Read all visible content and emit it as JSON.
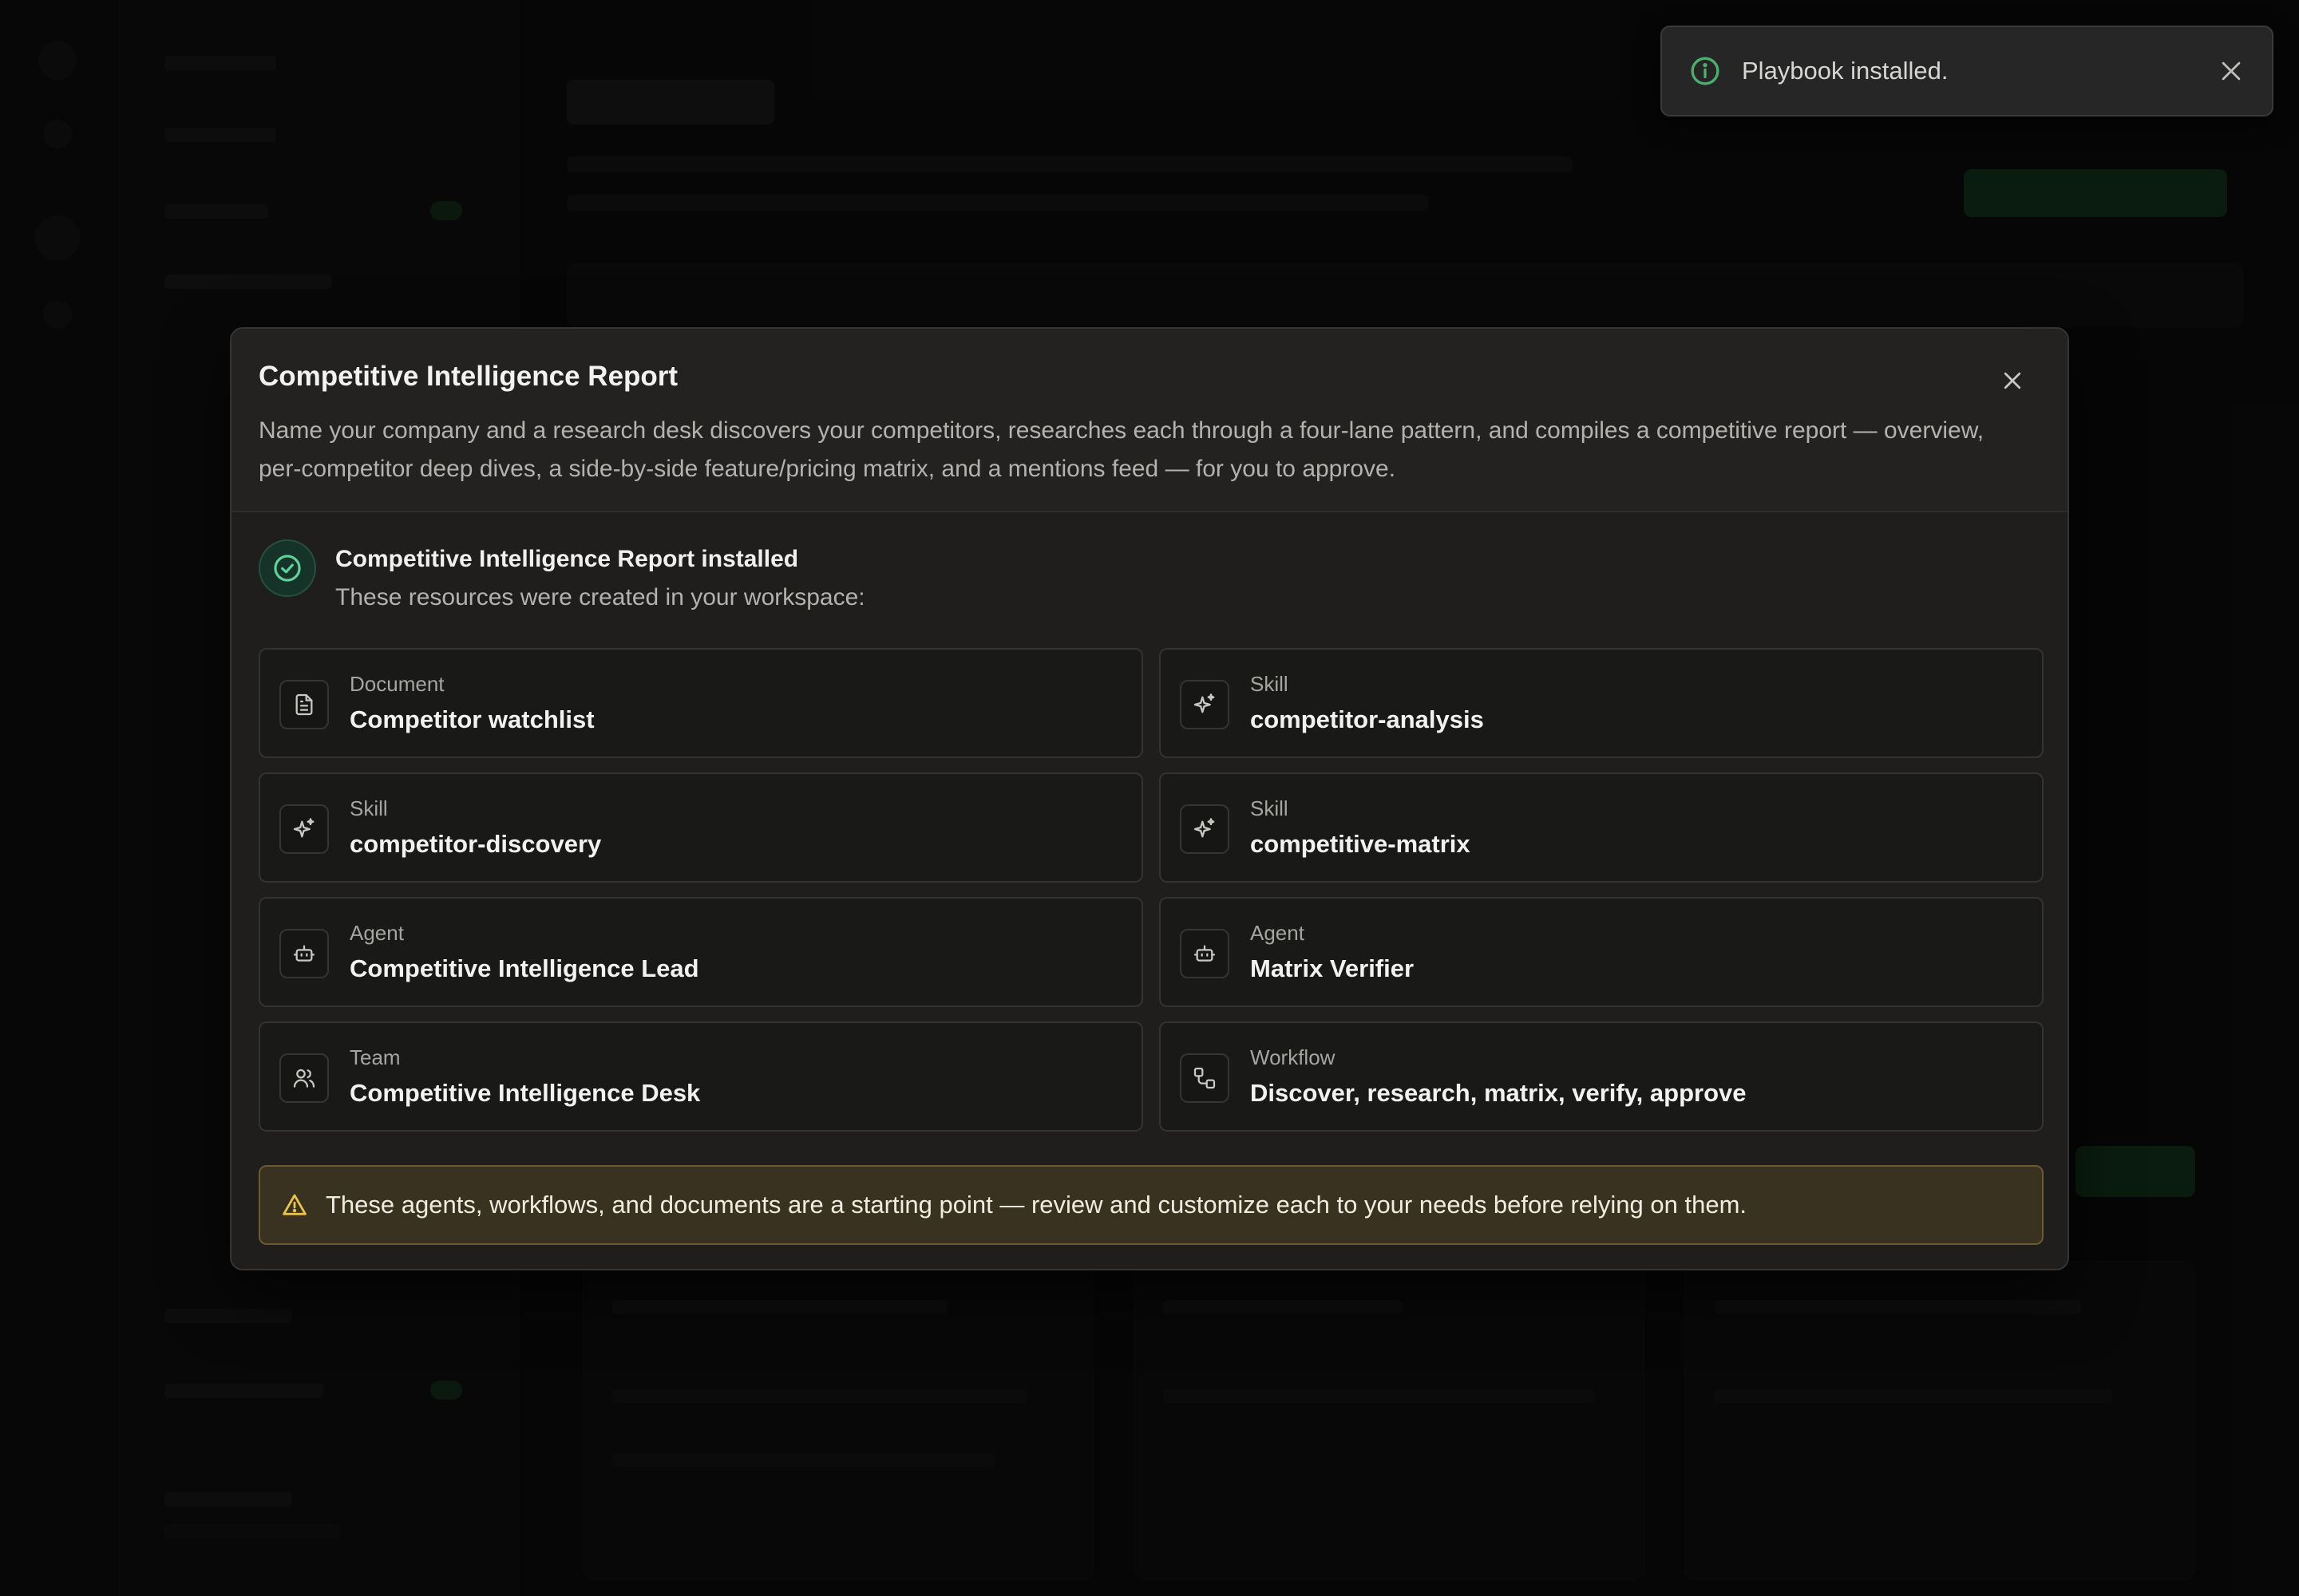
{
  "toast": {
    "message": "Playbook installed."
  },
  "modal": {
    "title": "Competitive Intelligence Report",
    "description": "Name your company and a research desk discovers your competitors, researches each through a four-lane pattern, and compiles a competitive report — overview, per-competitor deep dives, a side-by-side feature/pricing matrix, and a mentions feed — for you to approve.",
    "installed_title": "Competitive Intelligence Report installed",
    "installed_subtitle": "These resources were created in your workspace:",
    "resources": [
      {
        "type": "Document",
        "name": "Competitor watchlist",
        "icon": "document-icon"
      },
      {
        "type": "Skill",
        "name": "competitor-analysis",
        "icon": "sparkles-icon"
      },
      {
        "type": "Skill",
        "name": "competitor-discovery",
        "icon": "sparkles-icon"
      },
      {
        "type": "Skill",
        "name": "competitive-matrix",
        "icon": "sparkles-icon"
      },
      {
        "type": "Agent",
        "name": "Competitive Intelligence Lead",
        "icon": "robot-icon"
      },
      {
        "type": "Agent",
        "name": "Matrix Verifier",
        "icon": "robot-icon"
      },
      {
        "type": "Team",
        "name": "Competitive Intelligence Desk",
        "icon": "users-icon"
      },
      {
        "type": "Workflow",
        "name": "Discover, research, matrix, verify, approve",
        "icon": "workflow-icon"
      }
    ],
    "warning": "These agents, workflows, and documents are a starting point — review and customize each to your needs before relying on them."
  },
  "colors": {
    "success": "#4caf6e",
    "warning": "#e8c24a",
    "modal_bg": "#1f1e1d"
  }
}
